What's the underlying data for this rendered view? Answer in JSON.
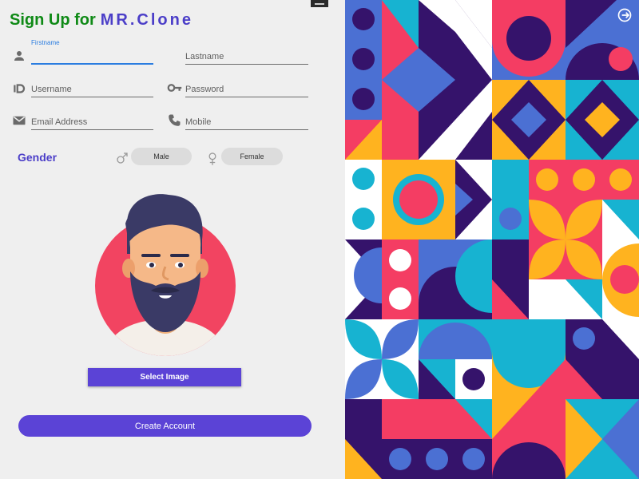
{
  "header": {
    "title_prefix": "Sign Up for",
    "title_brand": "MR.Clone"
  },
  "form": {
    "firstname": {
      "label": "Firstname",
      "value": "",
      "placeholder": ""
    },
    "lastname": {
      "placeholder": "Lastname"
    },
    "username": {
      "placeholder": "Username"
    },
    "password": {
      "placeholder": "Password"
    },
    "email": {
      "placeholder": "Email Address"
    },
    "mobile": {
      "placeholder": "Mobile"
    }
  },
  "gender": {
    "label": "Gender",
    "male": "Male",
    "female": "Female"
  },
  "buttons": {
    "select_image": "Select Image",
    "create_account": "Create Account"
  },
  "icons": {
    "firstname": "person-icon",
    "username": "id-card-icon",
    "password": "key-icon",
    "email": "mail-icon",
    "mobile": "phone-icon",
    "male": "male-symbol-icon",
    "female": "female-symbol-icon",
    "logout": "logout-icon"
  },
  "colors": {
    "brand_green": "#0f8a16",
    "brand_purple": "#4b3ec8",
    "accent_button": "#5b43d6",
    "focus_blue": "#2b7de0",
    "pattern_red": "#f43d63",
    "pattern_yellow": "#ffb31f",
    "pattern_cyan": "#17b3d1",
    "pattern_navy": "#35136b",
    "pattern_blue": "#4b70d3"
  }
}
